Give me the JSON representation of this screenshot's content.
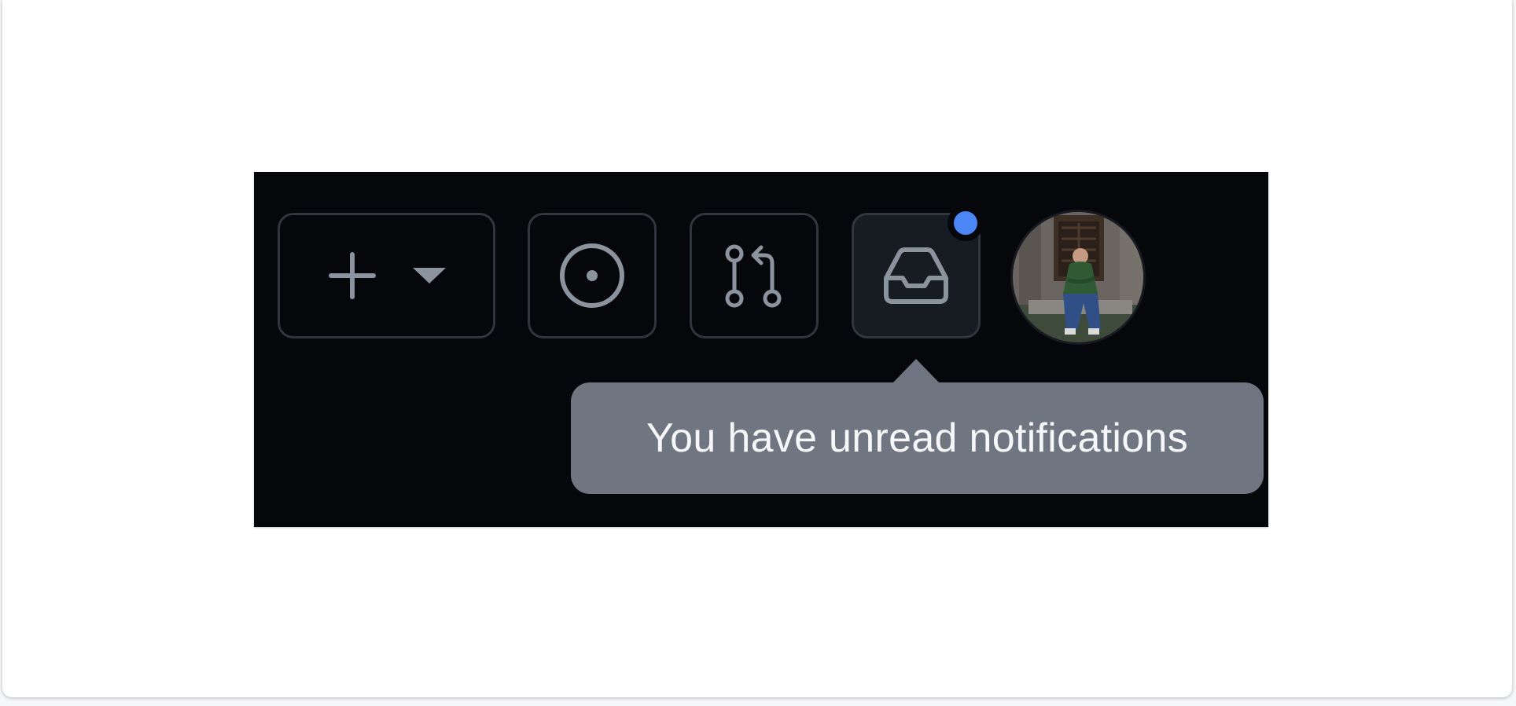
{
  "header_actions": {
    "create_button": {
      "icons": [
        "plus-icon",
        "triangle-down-icon"
      ]
    },
    "issues_button": {
      "icon": "issue-opened-icon"
    },
    "pull_requests_button": {
      "icon": "git-pull-request-icon"
    },
    "notifications_button": {
      "icon": "inbox-icon",
      "unread": true,
      "unread_dot_color": "#4a86f6"
    },
    "avatar": {
      "alt": ""
    }
  },
  "tooltip": {
    "text": "You have unread notifications"
  },
  "colors": {
    "panel_bg": "#05070b",
    "button_border": "#30363d",
    "active_button_bg": "#171b22",
    "icon": "#8b949e",
    "tooltip_bg": "#6f7681",
    "tooltip_text": "#f6f7f9"
  }
}
